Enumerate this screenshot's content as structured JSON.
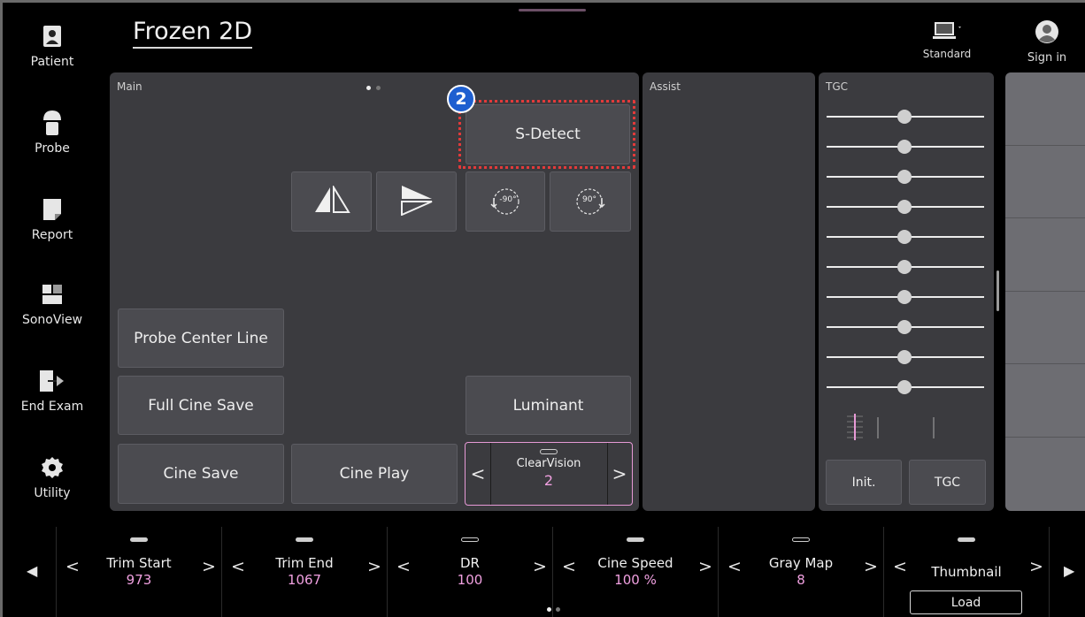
{
  "header": {
    "title": "Frozen 2D",
    "monitor_label": "Standard",
    "signin_label": "Sign in"
  },
  "sidebar": {
    "items": [
      {
        "label": "Patient",
        "icon": "patient-icon"
      },
      {
        "label": "Probe",
        "icon": "probe-icon"
      },
      {
        "label": "Report",
        "icon": "report-icon"
      },
      {
        "label": "SonoView",
        "icon": "sonoview-icon"
      },
      {
        "label": "End Exam",
        "icon": "end-exam-icon"
      },
      {
        "label": "Utility",
        "icon": "gear-icon"
      }
    ]
  },
  "main": {
    "title": "Main",
    "sdetect_label": "S-Detect",
    "badge_number": "2",
    "rotate_left_label": "-90°",
    "rotate_right_label": "90°",
    "probe_center_line": "Probe Center Line",
    "full_cine_save": "Full Cine Save",
    "cine_save": "Cine Save",
    "cine_play": "Cine Play",
    "luminant": "Luminant",
    "clearvision": {
      "label": "ClearVision",
      "value": "2"
    }
  },
  "assist": {
    "title": "Assist"
  },
  "tgc": {
    "title": "TGC",
    "init_label": "Init.",
    "tgc_label": "TGC",
    "slider_count": 10
  },
  "bottom": {
    "items": [
      {
        "label": "Trim Start",
        "value": "973"
      },
      {
        "label": "Trim End",
        "value": "1067"
      },
      {
        "label": "DR",
        "value": "100"
      },
      {
        "label": "Cine Speed",
        "value": "100 %"
      },
      {
        "label": "Gray Map",
        "value": "8"
      },
      {
        "label": "Thumbnail",
        "value": ""
      }
    ],
    "load_label": "Load"
  },
  "colors": {
    "accent_pink": "#f0a0e0",
    "highlight_red": "#e23a3a",
    "badge_blue": "#1e5fd0"
  }
}
